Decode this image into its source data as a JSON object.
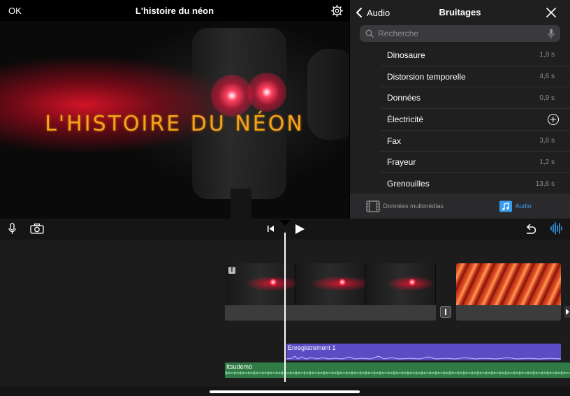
{
  "viewer": {
    "ok_label": "OK",
    "project_title": "L'histoire du néon",
    "title_overlay": "L'HISTOIRE DU NÉON",
    "settings_icon": "gear-icon"
  },
  "sound_panel": {
    "back_label": "Audio",
    "title": "Bruitages",
    "search_placeholder": "Recherche",
    "items": [
      {
        "name": "Dinosaure",
        "duration": "1,9 s"
      },
      {
        "name": "Distorsion temporelle",
        "duration": "4,6 s"
      },
      {
        "name": "Données",
        "duration": "0,9 s"
      },
      {
        "name": "Électricité",
        "duration": ""
      },
      {
        "name": "Fax",
        "duration": "3,6 s"
      },
      {
        "name": "Frayeur",
        "duration": "1,2 s"
      },
      {
        "name": "Grenouilles",
        "duration": "13,6 s"
      }
    ],
    "tabs": [
      {
        "label": "Données multimédias",
        "icon": "media-icon",
        "active": false
      },
      {
        "label": "Audio",
        "icon": "music-note-icon",
        "active": true
      }
    ]
  },
  "timeline": {
    "audio_clip_label": "Enregistrement 1",
    "music_clip_label": "Itsudemo",
    "title_badge": "T"
  },
  "colors": {
    "accent": "#3a9cf0",
    "title_text": "#f2a51c",
    "voice_track": "#5b4cc4",
    "music_track": "#2f7a45"
  }
}
